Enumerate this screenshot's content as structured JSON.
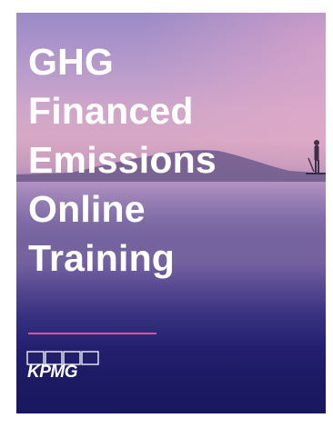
{
  "cover": {
    "title_lines": [
      "GHG",
      "Financed",
      "Emissions",
      "Online",
      "Training"
    ],
    "accent_color": "#e0519a",
    "logo_text": "KPMG"
  }
}
